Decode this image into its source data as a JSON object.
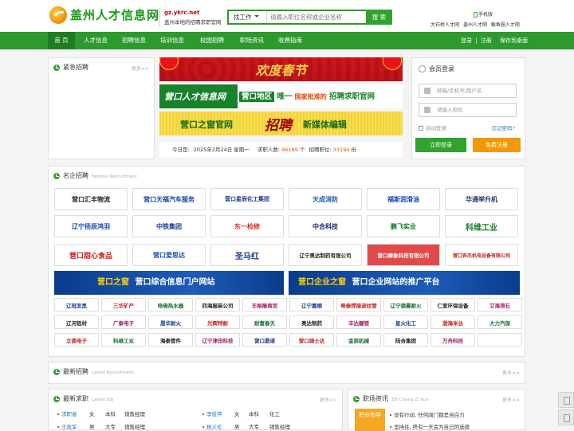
{
  "header": {
    "logo_text": "盖州人才信息网",
    "site_url": "gz.ykrc.net",
    "slogan": "盖州本地的招聘求职官网",
    "search": {
      "select": "找工作",
      "placeholder": "请输入职位名称或企业名称",
      "button": "搜 索"
    },
    "mobile": "手机版",
    "links_row1": "大石桥人才网",
    "links_row1b": "盖州人才网",
    "links_row2": "鲅鱼圈人才网"
  },
  "nav": {
    "items": [
      "首 页",
      "人才信息",
      "招聘信息",
      "培训信息",
      "校园招聘",
      "职场资讯",
      "收费指南"
    ],
    "login": "登录",
    "sep": "|",
    "register": "注册",
    "save_desktop": "保存到桌面"
  },
  "urgent": {
    "title": "紧急招聘",
    "more": "更多>>"
  },
  "banners": {
    "b1": "欢度春节",
    "b2_brand": "营口人才信息网",
    "b2_text1": "营口地区",
    "b2_text2": "唯一",
    "b2_text3": "国家批准的",
    "b2_text4": "招聘求职官网",
    "b3_left": "营口之窗官网",
    "b3_big": "招聘",
    "b3_right": "新媒体编辑"
  },
  "stats": {
    "date_label": "今日是:",
    "date": "2025年2月24日 星期一",
    "seekers_label": "求职人数:",
    "seekers": "96189",
    "seekers_unit": "个",
    "jobs_label": "招聘职位:",
    "jobs": "33194",
    "jobs_unit": "份"
  },
  "login": {
    "title": "会员登录",
    "username_ph": "邮箱/手机号/用户名",
    "password_ph": "请输入密码",
    "auto_login": "自动登录",
    "forgot": "忘记密码?",
    "login_btn": "立即登录",
    "register_btn": "免费注册"
  },
  "famous": {
    "title": "名企招聘",
    "subtitle": "Famous Recruitment",
    "row1": [
      "营口汇丰物流",
      "营口天福汽车服务",
      "营口星辰化工集团",
      "天成消防",
      "福斯润滑油",
      "华通举升机"
    ],
    "row2": [
      "辽宁扬辰鸿羽",
      "中铁集团",
      "东一检修",
      "中合科技",
      "鹏飞实业",
      "科维工业"
    ],
    "row3": [
      "营口甜心食品",
      "营口爱思达",
      "圣马红",
      "辽宁奥达制药有限公司",
      "营口摩象科技有限公司",
      "营口奔杰机电设备有限公司"
    ],
    "big1": {
      "prefix": "营口之窗",
      "text": "营口综合信息门户网站"
    },
    "big2": {
      "prefix": "营口企业之窗",
      "text": "营口企业网站的推广平台"
    },
    "small": [
      [
        "辽冠发黑",
        "三华矿产",
        "哈佛热水器",
        "四海服装公司",
        "丰裕隆商贸",
        "辽宁嘉顺",
        "希泰焊接波纹管",
        "辽宁德曼耐火",
        "仁爱环保设备",
        "艾海滑石"
      ],
      [
        "辽河铝材",
        "广泰电子",
        "晟华耐火",
        "光辉特耐",
        "财富春天",
        "奥达制药",
        "丰达硼镁",
        "星火化工",
        "渤海米业",
        "大力汽保"
      ],
      [
        "立德电子",
        "科维工业",
        "海泰管件",
        "辽宁津田科技",
        "营口鼎诺",
        "营口骑士达",
        "金辰机械",
        "陆合集团",
        "万舟科技",
        ""
      ]
    ]
  },
  "latest": {
    "title": "最新招聘",
    "subtitle": "Latest Recruitment",
    "more": "更多>>"
  },
  "seek": {
    "title": "最新求职",
    "subtitle": "Latest Job",
    "more": "更多>>",
    "rows": [
      {
        "name": "求职者",
        "gender": "女",
        "edu": "本科",
        "job": "销售经理",
        "name2": "李俊萍",
        "gender2": "女",
        "edu2": "本科",
        "job2": "化工"
      },
      {
        "name": "王政军",
        "gender": "男",
        "edu": "大专",
        "job": "销售经理",
        "name2": "杨义伦",
        "gender2": "男",
        "edu2": "大专",
        "job2": "销售经理"
      }
    ]
  },
  "news": {
    "title": "职场资讯",
    "subtitle": "ZN Chang Zi Xun",
    "more": "更多>>",
    "thumb": "职业指导",
    "items": [
      "没有行动, 任何阔门都是自白力",
      "坚持住, 终有一天会为自己的选择"
    ]
  }
}
